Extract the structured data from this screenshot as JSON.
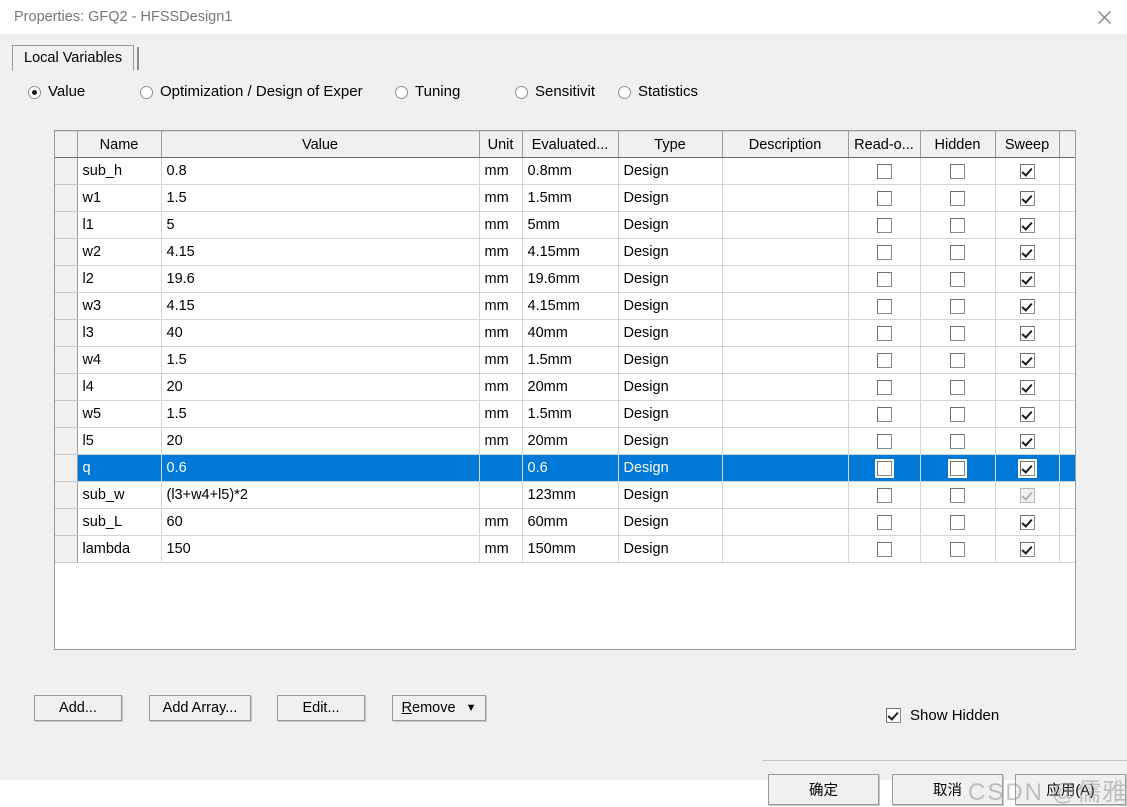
{
  "window": {
    "title": "Properties: GFQ2 - HFSSDesign1",
    "close_icon": "close-icon"
  },
  "tabs": [
    {
      "label": "Local Variables",
      "selected": true
    }
  ],
  "radio_group": {
    "selected": "Value",
    "options": [
      {
        "label": "Value",
        "checked": true
      },
      {
        "label": "Optimization / Design of Exper",
        "checked": false
      },
      {
        "label": "Tuning",
        "checked": false
      },
      {
        "label": "Sensitivit",
        "checked": false
      },
      {
        "label": "Statistics",
        "checked": false
      }
    ]
  },
  "grid": {
    "columns": [
      "",
      "Name",
      "Value",
      "Unit",
      "Evaluated...",
      "Type",
      "Description",
      "Read-o...",
      "Hidden",
      "Sweep",
      ""
    ],
    "rows": [
      {
        "name": "sub_h",
        "value": "0.8",
        "unit": "mm",
        "evaluated": "0.8mm",
        "type": "Design",
        "description": "",
        "readonly": false,
        "hidden": false,
        "sweep": true,
        "sweep_disabled": false,
        "selected": false
      },
      {
        "name": "w1",
        "value": "1.5",
        "unit": "mm",
        "evaluated": "1.5mm",
        "type": "Design",
        "description": "",
        "readonly": false,
        "hidden": false,
        "sweep": true,
        "sweep_disabled": false,
        "selected": false
      },
      {
        "name": "l1",
        "value": "5",
        "unit": "mm",
        "evaluated": "5mm",
        "type": "Design",
        "description": "",
        "readonly": false,
        "hidden": false,
        "sweep": true,
        "sweep_disabled": false,
        "selected": false
      },
      {
        "name": "w2",
        "value": "4.15",
        "unit": "mm",
        "evaluated": "4.15mm",
        "type": "Design",
        "description": "",
        "readonly": false,
        "hidden": false,
        "sweep": true,
        "sweep_disabled": false,
        "selected": false
      },
      {
        "name": "l2",
        "value": "19.6",
        "unit": "mm",
        "evaluated": "19.6mm",
        "type": "Design",
        "description": "",
        "readonly": false,
        "hidden": false,
        "sweep": true,
        "sweep_disabled": false,
        "selected": false
      },
      {
        "name": "w3",
        "value": "4.15",
        "unit": "mm",
        "evaluated": "4.15mm",
        "type": "Design",
        "description": "",
        "readonly": false,
        "hidden": false,
        "sweep": true,
        "sweep_disabled": false,
        "selected": false
      },
      {
        "name": "l3",
        "value": "40",
        "unit": "mm",
        "evaluated": "40mm",
        "type": "Design",
        "description": "",
        "readonly": false,
        "hidden": false,
        "sweep": true,
        "sweep_disabled": false,
        "selected": false
      },
      {
        "name": "w4",
        "value": "1.5",
        "unit": "mm",
        "evaluated": "1.5mm",
        "type": "Design",
        "description": "",
        "readonly": false,
        "hidden": false,
        "sweep": true,
        "sweep_disabled": false,
        "selected": false
      },
      {
        "name": "l4",
        "value": "20",
        "unit": "mm",
        "evaluated": "20mm",
        "type": "Design",
        "description": "",
        "readonly": false,
        "hidden": false,
        "sweep": true,
        "sweep_disabled": false,
        "selected": false
      },
      {
        "name": "w5",
        "value": "1.5",
        "unit": "mm",
        "evaluated": "1.5mm",
        "type": "Design",
        "description": "",
        "readonly": false,
        "hidden": false,
        "sweep": true,
        "sweep_disabled": false,
        "selected": false
      },
      {
        "name": "l5",
        "value": "20",
        "unit": "mm",
        "evaluated": "20mm",
        "type": "Design",
        "description": "",
        "readonly": false,
        "hidden": false,
        "sweep": true,
        "sweep_disabled": false,
        "selected": false
      },
      {
        "name": "q",
        "value": "0.6",
        "unit": "",
        "evaluated": "0.6",
        "type": "Design",
        "description": "",
        "readonly": false,
        "hidden": false,
        "sweep": true,
        "sweep_disabled": false,
        "selected": true
      },
      {
        "name": "sub_w",
        "value": "(l3+w4+l5)*2",
        "unit": "",
        "evaluated": "123mm",
        "type": "Design",
        "description": "",
        "readonly": false,
        "hidden": false,
        "sweep": true,
        "sweep_disabled": true,
        "selected": false
      },
      {
        "name": "sub_L",
        "value": "60",
        "unit": "mm",
        "evaluated": "60mm",
        "type": "Design",
        "description": "",
        "readonly": false,
        "hidden": false,
        "sweep": true,
        "sweep_disabled": false,
        "selected": false
      },
      {
        "name": "lambda",
        "value": "150",
        "unit": "mm",
        "evaluated": "150mm",
        "type": "Design",
        "description": "",
        "readonly": false,
        "hidden": false,
        "sweep": true,
        "sweep_disabled": false,
        "selected": false
      }
    ]
  },
  "buttons": {
    "add": "Add...",
    "add_array": "Add Array...",
    "edit": "Edit...",
    "remove_accel": "R",
    "remove_rest": "emove",
    "remove_caret": "▼"
  },
  "show_hidden": {
    "label": "Show Hidden",
    "checked": true
  },
  "footer": {
    "ok": "确定",
    "cancel": "取消",
    "apply": "应用(A)"
  },
  "watermark": {
    "csdn": "CSDN",
    "handle": "@儒雅的缘"
  },
  "colors": {
    "selection": "#0078d7",
    "dialog_bg": "#f0f0f0",
    "grid_bg": "#ffffff",
    "title_text": "#777777"
  }
}
